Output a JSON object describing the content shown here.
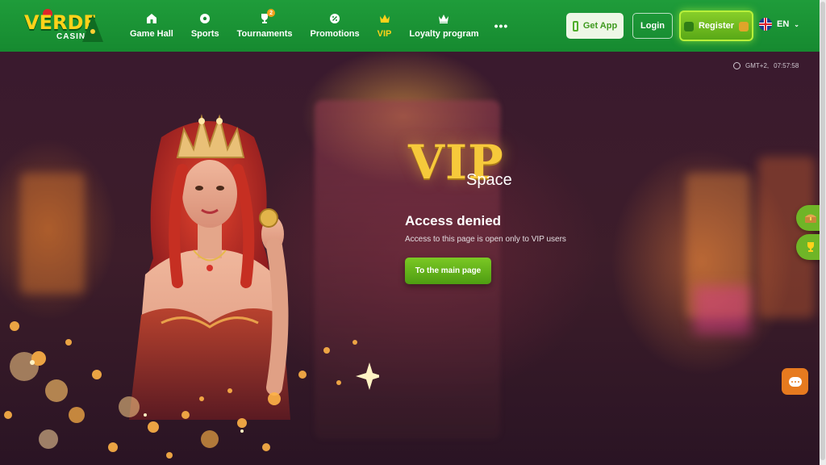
{
  "brand": {
    "logo_text": "VERDE",
    "logo_sub": "CASINO"
  },
  "nav": {
    "items": [
      {
        "label": "Game Hall",
        "icon": "home-icon"
      },
      {
        "label": "Sports",
        "icon": "soccer-ball-icon"
      },
      {
        "label": "Tournaments",
        "icon": "trophy-icon",
        "badge": "2"
      },
      {
        "label": "Promotions",
        "icon": "percent-icon"
      },
      {
        "label": "VIP",
        "icon": "crown-icon",
        "active": true
      },
      {
        "label": "Loyalty program",
        "icon": "crown-outline-icon"
      }
    ],
    "more": "•••"
  },
  "header_actions": {
    "get_app": "Get App",
    "login": "Login",
    "register": "Register",
    "language": "EN"
  },
  "timezone": {
    "label": "GMT+2,",
    "time": "07:57:58"
  },
  "content": {
    "vip_title": "VIP",
    "vip_subtitle": "Space",
    "access_title": "Access denied",
    "access_text": "Access to this page is open only to VIP users",
    "main_button": "To the main page"
  },
  "colors": {
    "header_green": "#1f9c3a",
    "vip_gold": "#f6c93b",
    "button_green": "#6cb81e",
    "chat_orange": "#e67a1f"
  }
}
